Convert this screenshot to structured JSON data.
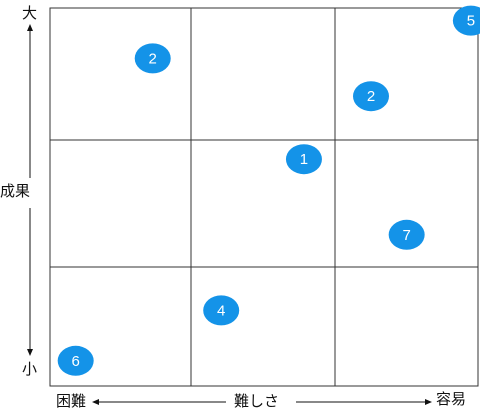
{
  "y_axis": {
    "top_label": "大",
    "middle_label": "成果",
    "bottom_label": "小"
  },
  "x_axis": {
    "left_label": "困難",
    "middle_label": "難しさ",
    "right_label": "容易"
  },
  "grid": {
    "rows": 3,
    "columns": 3,
    "line_color": "#333333"
  },
  "markers": {
    "fill_color": "#1493e8",
    "text_color": "#ffffff",
    "items": [
      {
        "label": "5",
        "difficulty": 2.95,
        "result": 2.9
      },
      {
        "label": "2",
        "difficulty": 0.72,
        "result": 2.6
      },
      {
        "label": "2",
        "difficulty": 2.25,
        "result": 2.3
      },
      {
        "label": "1",
        "difficulty": 1.78,
        "result": 1.8
      },
      {
        "label": "7",
        "difficulty": 2.5,
        "result": 1.2
      },
      {
        "label": "4",
        "difficulty": 1.2,
        "result": 0.6
      },
      {
        "label": "6",
        "difficulty": 0.18,
        "result": 0.2
      }
    ]
  }
}
